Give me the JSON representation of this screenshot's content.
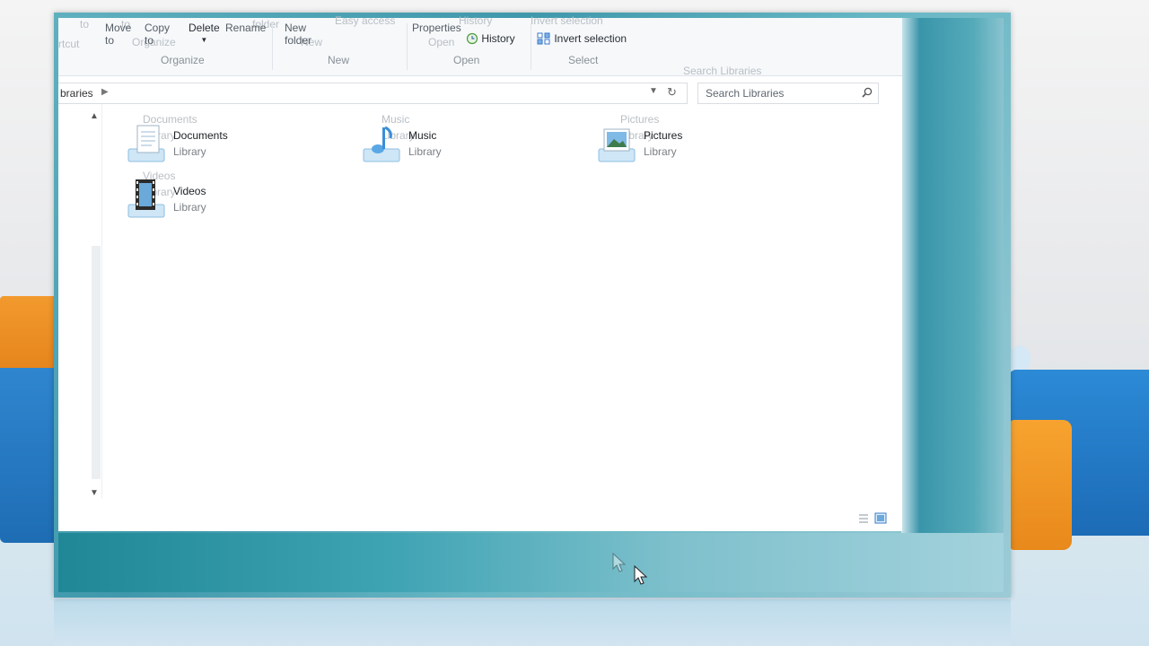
{
  "ribbon": {
    "ghost": {
      "shortcut": "rtcut",
      "to1": "to",
      "to2": "to",
      "folder": "folder",
      "easy_access": "Easy access",
      "history": "History",
      "invert_selection": "Invert selection",
      "organize": "Organize",
      "new": "New",
      "open": "Open",
      "select": "Select",
      "documents": "Documents",
      "library_doc": "Library",
      "music": "Music",
      "library_music": "Library",
      "pictures": "Pictures",
      "library_pic": "Library",
      "videos": "Videos",
      "library_vid": "Library",
      "search": "Search Libraries"
    },
    "move_to": "Move to",
    "copy_to": "Copy to",
    "delete": "Delete",
    "rename": "Rename",
    "new_folder": "New folder",
    "properties": "Properties",
    "history": "History",
    "invert_selection": "Invert selection",
    "groups": {
      "organize": "Organize",
      "new": "New",
      "open": "Open",
      "select": "Select"
    }
  },
  "address": {
    "path": "braries",
    "search_placeholder": "Search Libraries"
  },
  "libraries": [
    {
      "name": "Documents",
      "type": "Library",
      "icon": "documents-library-icon"
    },
    {
      "name": "Music",
      "type": "Library",
      "icon": "music-library-icon"
    },
    {
      "name": "Pictures",
      "type": "Library",
      "icon": "pictures-library-icon"
    },
    {
      "name": "Videos",
      "type": "Library",
      "icon": "videos-library-icon"
    }
  ],
  "colors": {
    "aero_teal": "#3f98ab",
    "orange": "#f29a2e",
    "blue": "#2f86cf"
  }
}
